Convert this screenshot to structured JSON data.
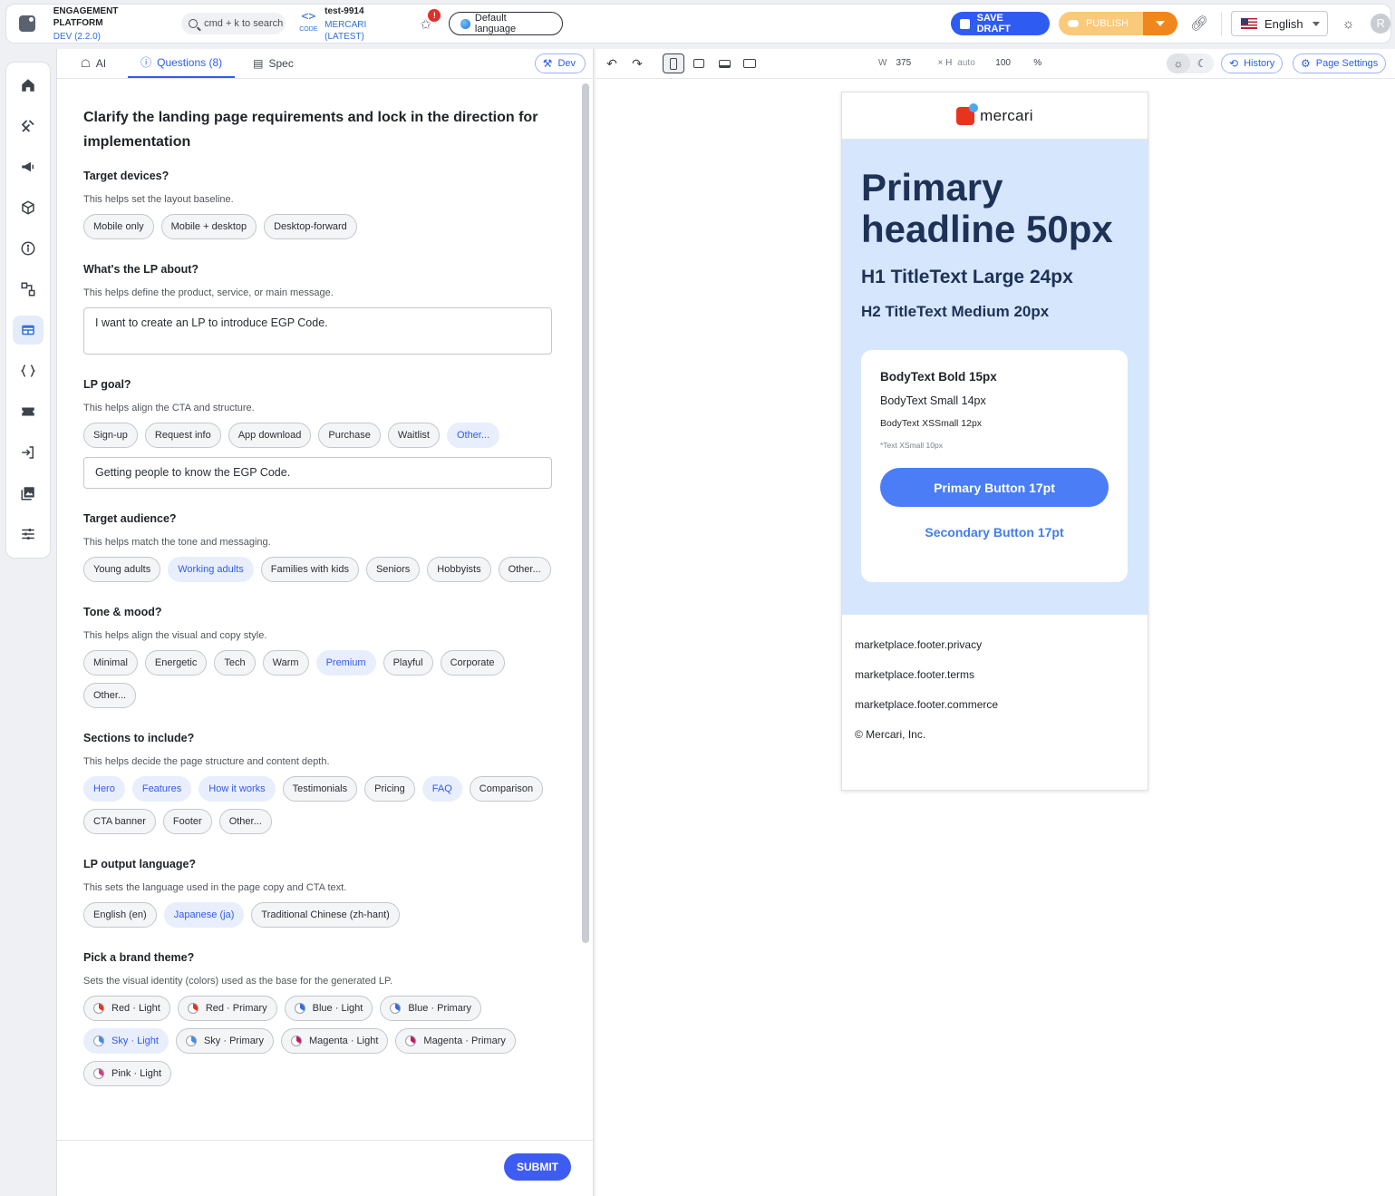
{
  "topbar": {
    "brand_title": "ENGAGEMENT PLATFORM",
    "brand_env": "DEV (2.2.0)",
    "search_placeholder": "cmd + k to search",
    "code_label": "CODE",
    "project_name": "test-9914",
    "project_version": "MERCARI (LATEST)",
    "alert_count": "!",
    "default_language": "Default language",
    "save_draft": "SAVE DRAFT",
    "publish": "PUBLISH",
    "language": "English",
    "avatar_initial": "R"
  },
  "tabs": {
    "ai": "AI",
    "questions": "Questions (8)",
    "spec": "Spec",
    "dev": "Dev"
  },
  "questions": {
    "title": "Clarify the landing page requirements and lock in the direction for implementation",
    "items": [
      {
        "label": "Target devices?",
        "help": "This helps set the layout baseline.",
        "options": [
          "Mobile only",
          "Mobile + desktop",
          "Desktop-forward"
        ],
        "selected": []
      },
      {
        "label": "What's the LP about?",
        "help": "This helps define the product, service, or main message.",
        "value": "I want to create an LP to introduce EGP Code."
      },
      {
        "label": "LP goal?",
        "help": "This helps align the CTA and structure.",
        "options": [
          "Sign-up",
          "Request info",
          "App download",
          "Purchase",
          "Waitlist",
          "Other..."
        ],
        "selected": [
          "Other..."
        ],
        "value": "Getting people to know the EGP Code."
      },
      {
        "label": "Target audience?",
        "help": "This helps match the tone and messaging.",
        "options": [
          "Young adults",
          "Working adults",
          "Families with kids",
          "Seniors",
          "Hobbyists",
          "Other..."
        ],
        "selected": [
          "Working adults"
        ]
      },
      {
        "label": "Tone & mood?",
        "help": "This helps align the visual and copy style.",
        "options": [
          "Minimal",
          "Energetic",
          "Tech",
          "Warm",
          "Premium",
          "Playful",
          "Corporate",
          "Other..."
        ],
        "selected": [
          "Premium"
        ]
      },
      {
        "label": "Sections to include?",
        "help": "This helps decide the page structure and content depth.",
        "options": [
          "Hero",
          "Features",
          "How it works",
          "Testimonials",
          "Pricing",
          "FAQ",
          "Comparison",
          "CTA banner",
          "Footer",
          "Other..."
        ],
        "selected": [
          "Hero",
          "Features",
          "How it works",
          "FAQ"
        ]
      },
      {
        "label": "LP output language?",
        "help": "This sets the language used in the page copy and CTA text.",
        "options": [
          "English (en)",
          "Japanese (ja)",
          "Traditional Chinese (zh-hant)"
        ],
        "selected": [
          "Japanese (ja)"
        ]
      },
      {
        "label": "Pick a brand theme?",
        "help": "Sets the visual identity (colors) used as the base for the generated LP.",
        "themes": [
          {
            "name": "Red · Light",
            "color": "#e8341c"
          },
          {
            "name": "Red · Primary",
            "color": "#e8341c"
          },
          {
            "name": "Blue · Light",
            "color": "#2f6fe0"
          },
          {
            "name": "Blue · Primary",
            "color": "#2f6fe0"
          },
          {
            "name": "Sky · Light",
            "color": "#3b8fe8"
          },
          {
            "name": "Sky · Primary",
            "color": "#3b8fe8"
          },
          {
            "name": "Magenta · Light",
            "color": "#c2186b"
          },
          {
            "name": "Magenta · Primary",
            "color": "#c2186b"
          },
          {
            "name": "Pink · Light",
            "color": "#d23c8a"
          }
        ],
        "selected": [
          "Sky · Light"
        ]
      }
    ],
    "submit": "SUBMIT"
  },
  "preview_toolbar": {
    "width_label": "W",
    "width_value": "375",
    "height_label": "× H",
    "height_value": "auto",
    "zoom_value": "100",
    "zoom_unit": "%",
    "history": "History",
    "page_settings": "Page Settings"
  },
  "preview": {
    "logo_text": "mercari",
    "headline": "Primary headline 50px",
    "h1": "H1 TitleText Large 24px",
    "h2": "H2 TitleText Medium 20px",
    "body_bold": "BodyText Bold 15px",
    "body_small": "BodyText Small 14px",
    "body_xsmall": "BodyText XSSmall 12px",
    "text_xxsmall": "*Text XSmall 10px",
    "primary_button": "Primary Button 17pt",
    "secondary_button": "Secondary Button 17pt",
    "footer_links": [
      "marketplace.footer.privacy",
      "marketplace.footer.terms",
      "marketplace.footer.commerce"
    ],
    "copyright": "© Mercari, Inc."
  },
  "colors": {
    "accent": "#2f5cf0",
    "publish": "#f0861e",
    "hero_bg": "#d6e6fd",
    "headline": "#1d3256"
  }
}
